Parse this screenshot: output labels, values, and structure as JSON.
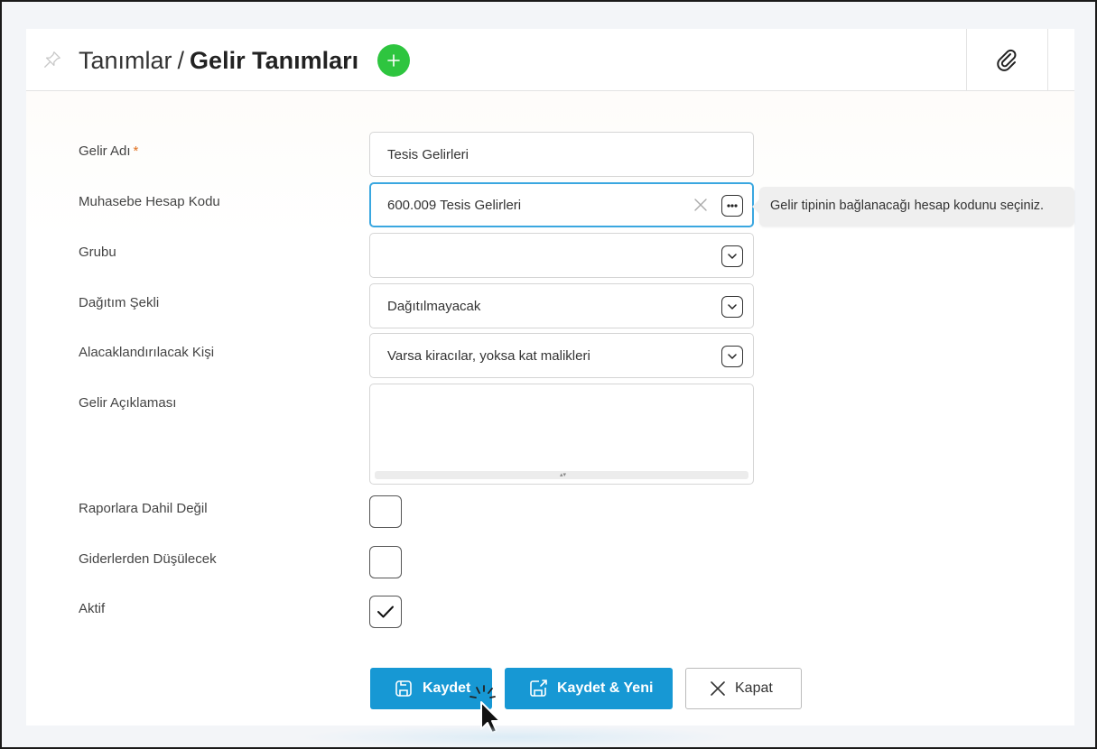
{
  "header": {
    "breadcrumb_parent": "Tanımlar",
    "breadcrumb_separator": "/",
    "breadcrumb_current": "Gelir Tanımları",
    "add_icon": "plus-icon",
    "attach_icon": "paperclip-icon",
    "add_color": "#2ec53f"
  },
  "form": {
    "gelir_adi": {
      "label": "Gelir Adı",
      "required_mark": "*",
      "value": "Tesis Gelirleri"
    },
    "muhasebe": {
      "label": "Muhasebe Hesap Kodu",
      "value": "600.009  Tesis Gelirleri",
      "focused": true
    },
    "grubu": {
      "label": "Grubu",
      "value": ""
    },
    "dagitim": {
      "label": "Dağıtım Şekli",
      "value": "Dağıtılmayacak"
    },
    "alacak": {
      "label": "Alacaklandırılacak Kişi",
      "value": "Varsa kiracılar, yoksa kat malikleri"
    },
    "aciklama": {
      "label": "Gelir Açıklaması",
      "value": ""
    },
    "raporlara": {
      "label": "Raporlara Dahil Değil",
      "checked": false
    },
    "giderler": {
      "label": "Giderlerden Düşülecek",
      "checked": false
    },
    "aktif": {
      "label": "Aktif",
      "checked": true
    }
  },
  "tooltip": {
    "text": "Gelir tipinin bağlanacağı hesap kodunu seçiniz."
  },
  "buttons": {
    "save": "Kaydet",
    "save_new": "Kaydet & Yeni",
    "close": "Kapat",
    "primary_color": "#1798d4"
  }
}
